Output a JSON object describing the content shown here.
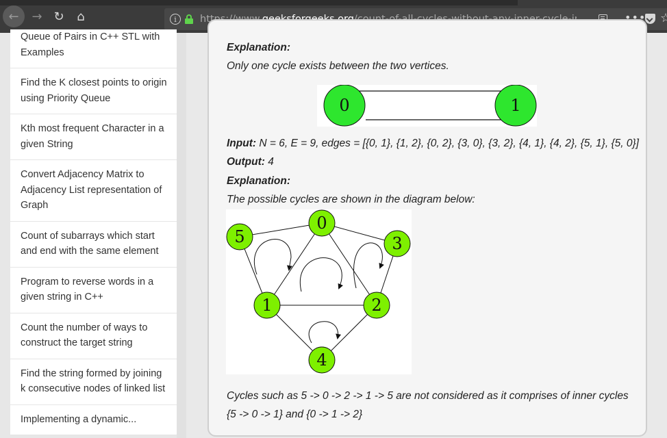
{
  "browser": {
    "url_prefix": "https://www.",
    "url_domain": "geeksforgeeks.org",
    "url_path": "/count-of-all-cycles-without-any-inner-cycle-in-a-gi"
  },
  "sidebar": {
    "items": [
      {
        "label": "Queue of Pairs in C++ STL with Examples"
      },
      {
        "label": "Find the K closest points to origin using Priority Queue"
      },
      {
        "label": "Kth most frequent Character in a given String"
      },
      {
        "label": "Convert Adjacency Matrix to Adjacency List representation of Graph"
      },
      {
        "label": "Count of subarrays which start and end with the same element"
      },
      {
        "label": "Program to reverse words in a given string in C++"
      },
      {
        "label": "Count the number of ways to construct the target string"
      },
      {
        "label": "Find the string formed by joining k consecutive nodes of linked list"
      },
      {
        "label": "Implementing a dynamic..."
      }
    ]
  },
  "article": {
    "explanation_label_1": "Explanation:",
    "explanation_text_1": "Only one cycle exists between the two vertices.",
    "input_label": "Input:",
    "input_text": " N = 6, E = 9, edges = [{0, 1}, {1, 2}, {0, 2}, {3, 0}, {3, 2}, {4, 1}, {4, 2}, {5, 1}, {5, 0}]",
    "output_label": "Output:",
    "output_text": " 4",
    "explanation_label_2": "Explanation:",
    "explanation_text_2": "The possible cycles are shown in the diagram below:",
    "conclusion_line_1": "Cycles such as 5 -> 0 -> 2 -> 1 -> 5 are not considered as it comprises of inner cycles",
    "conclusion_line_2": "{5 -> 0 -> 1} and {0 -> 1 -> 2}"
  },
  "diagram1": {
    "node_a": "0",
    "node_b": "1",
    "node_color": "#2ee62e"
  },
  "diagram2": {
    "node_color": "#7ef000",
    "nodes": [
      "0",
      "1",
      "2",
      "3",
      "4",
      "5"
    ]
  }
}
